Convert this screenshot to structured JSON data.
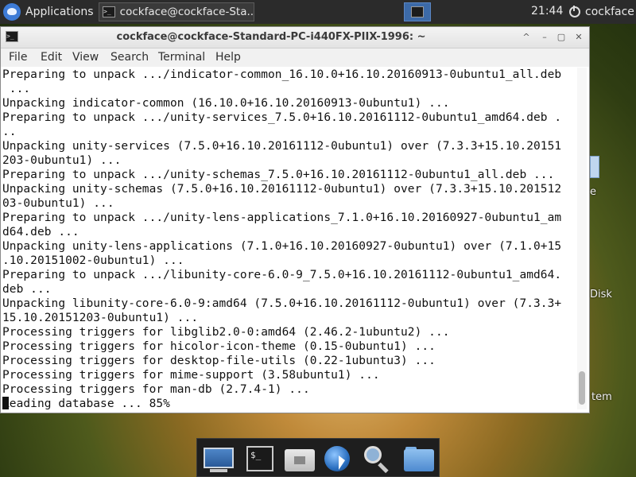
{
  "panel": {
    "applications_label": "Applications",
    "taskbar_item": "cockface@cockface-Sta...",
    "clock": "21:44",
    "user": "cockface"
  },
  "desktop": {
    "labels": [
      "e",
      "Disk",
      "tem"
    ]
  },
  "window": {
    "title": "cockface@cockface-Standard-PC-i440FX-PIIX-1996: ~",
    "controls": [
      "^",
      "–",
      "▢",
      "✕"
    ]
  },
  "menubar": [
    "File",
    "Edit",
    "View",
    "Search",
    "Terminal",
    "Help"
  ],
  "terminal": {
    "lines": [
      "Preparing to unpack .../indicator-common_16.10.0+16.10.20160913-0ubuntu1_all.deb",
      " ...",
      "Unpacking indicator-common (16.10.0+16.10.20160913-0ubuntu1) ...",
      "Preparing to unpack .../unity-services_7.5.0+16.10.20161112-0ubuntu1_amd64.deb .",
      "..",
      "Unpacking unity-services (7.5.0+16.10.20161112-0ubuntu1) over (7.3.3+15.10.20151",
      "203-0ubuntu1) ...",
      "Preparing to unpack .../unity-schemas_7.5.0+16.10.20161112-0ubuntu1_all.deb ...",
      "Unpacking unity-schemas (7.5.0+16.10.20161112-0ubuntu1) over (7.3.3+15.10.201512",
      "03-0ubuntu1) ...",
      "Preparing to unpack .../unity-lens-applications_7.1.0+16.10.20160927-0ubuntu1_am",
      "d64.deb ...",
      "Unpacking unity-lens-applications (7.1.0+16.10.20160927-0ubuntu1) over (7.1.0+15",
      ".10.20151002-0ubuntu1) ...",
      "Preparing to unpack .../libunity-core-6.0-9_7.5.0+16.10.20161112-0ubuntu1_amd64.",
      "deb ...",
      "Unpacking libunity-core-6.0-9:amd64 (7.5.0+16.10.20161112-0ubuntu1) over (7.3.3+",
      "15.10.20151203-0ubuntu1) ...",
      "Processing triggers for libglib2.0-0:amd64 (2.46.2-1ubuntu2) ...",
      "Processing triggers for hicolor-icon-theme (0.15-0ubuntu1) ...",
      "Processing triggers for desktop-file-utils (0.22-1ubuntu3) ...",
      "Processing triggers for mime-support (3.58ubuntu1) ...",
      "Processing triggers for man-db (2.7.4-1) ..."
    ],
    "last_line": "Reading database ... 85%"
  },
  "dock": {
    "items": [
      "show-desktop",
      "terminal",
      "home-folder",
      "web-browser",
      "app-finder",
      "file-manager"
    ],
    "terminal_prompt": "$_"
  }
}
